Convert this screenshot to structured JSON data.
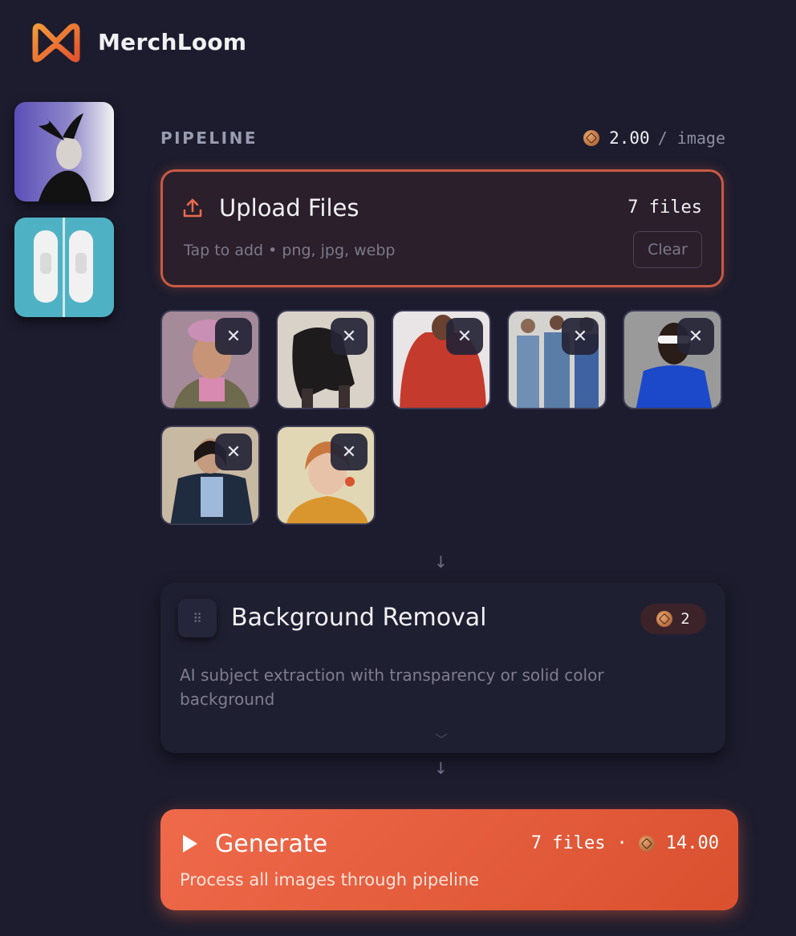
{
  "app": {
    "name": "MerchLoom"
  },
  "pipeline": {
    "label": "PIPELINE",
    "price_value": "2.00",
    "price_unit": "/ image"
  },
  "upload": {
    "title": "Upload Files",
    "count": "7 files",
    "hint": "Tap to add • png, jpg, webp",
    "clear_label": "Clear",
    "files": [
      {
        "remove": "✕"
      },
      {
        "remove": "✕"
      },
      {
        "remove": "✕"
      },
      {
        "remove": "✕"
      },
      {
        "remove": "✕"
      },
      {
        "remove": "✕"
      },
      {
        "remove": "✕"
      }
    ]
  },
  "steps": [
    {
      "title": "Background Removal",
      "cost": "2",
      "description": "AI subject extraction with transparency or solid color background"
    }
  ],
  "generate": {
    "title": "Generate",
    "files": "7 files",
    "separator": "·",
    "total": "14.00",
    "subtitle": "Process all images through pipeline"
  },
  "colors": {
    "background": "#1c1c2e",
    "accent": "#e85d3f",
    "upload_border": "#c85a44"
  },
  "icons": [
    "merchloom-logo-icon",
    "upload-icon",
    "coin-icon",
    "close-icon",
    "drag-handle-icon",
    "chevron-down-icon",
    "arrow-down-icon",
    "play-icon"
  ]
}
